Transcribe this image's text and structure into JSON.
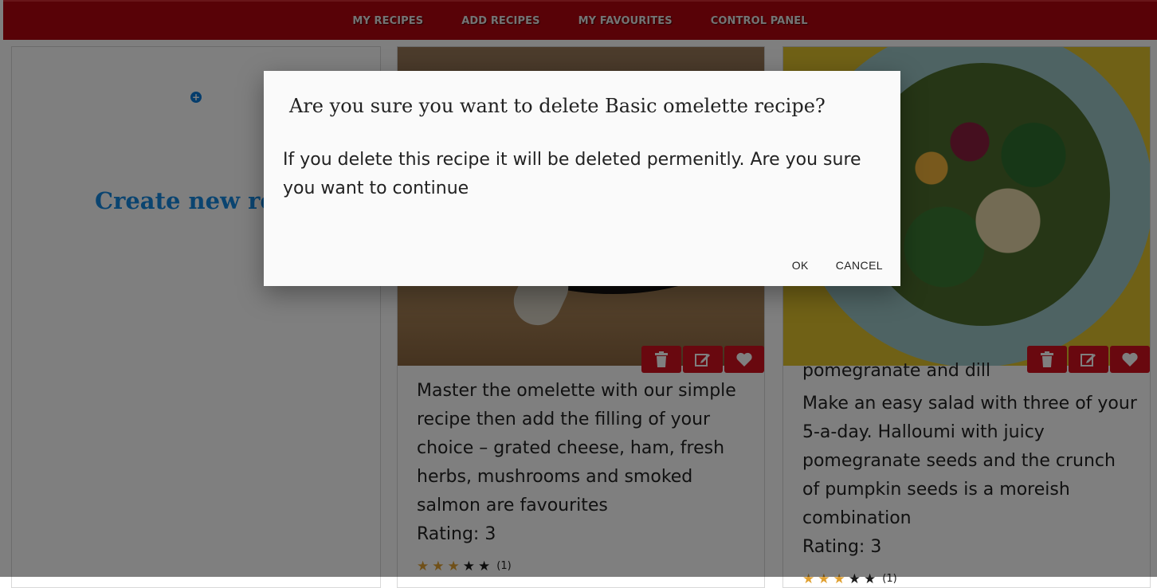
{
  "nav": {
    "items": [
      {
        "label": "MY RECIPES"
      },
      {
        "label": "ADD RECIPES"
      },
      {
        "label": "MY FAVOURITES"
      },
      {
        "label": "CONTROL PANEL"
      }
    ]
  },
  "create_panel": {
    "add_icon_glyph": "+",
    "link_text": "Create new reci"
  },
  "cards": [
    {
      "image": "omelette-photo",
      "title_fragment": "",
      "description": "Master the omelette with our simple recipe then add the filling of your choice – grated cheese, ham, fresh herbs, mushrooms and smoked salmon are favourites",
      "rating_label": "Rating: 3",
      "rating": 3,
      "max_rating": 5,
      "review_count": "(1)"
    },
    {
      "image": "salad-photo",
      "title_fragment": "pomegranate and dill",
      "description": "Make an easy salad with three of your 5-a-day. Halloumi with juicy pomegranate seeds and the crunch of pumpkin seeds is a moreish combination",
      "rating_label": "Rating: 3",
      "rating": 3,
      "max_rating": 5,
      "review_count": "(1)"
    }
  ],
  "dialog": {
    "title": "Are you sure you want to delete Basic omelette recipe?",
    "message": "If you delete this recipe it will be deleted permenitly. Are you sure you want to continue",
    "ok_label": "OK",
    "cancel_label": "CANCEL"
  },
  "colors": {
    "nav_bg": "#b0040f",
    "action_btn": "#d3101e",
    "link": "#1488e0",
    "star_on": "#e0a030"
  }
}
